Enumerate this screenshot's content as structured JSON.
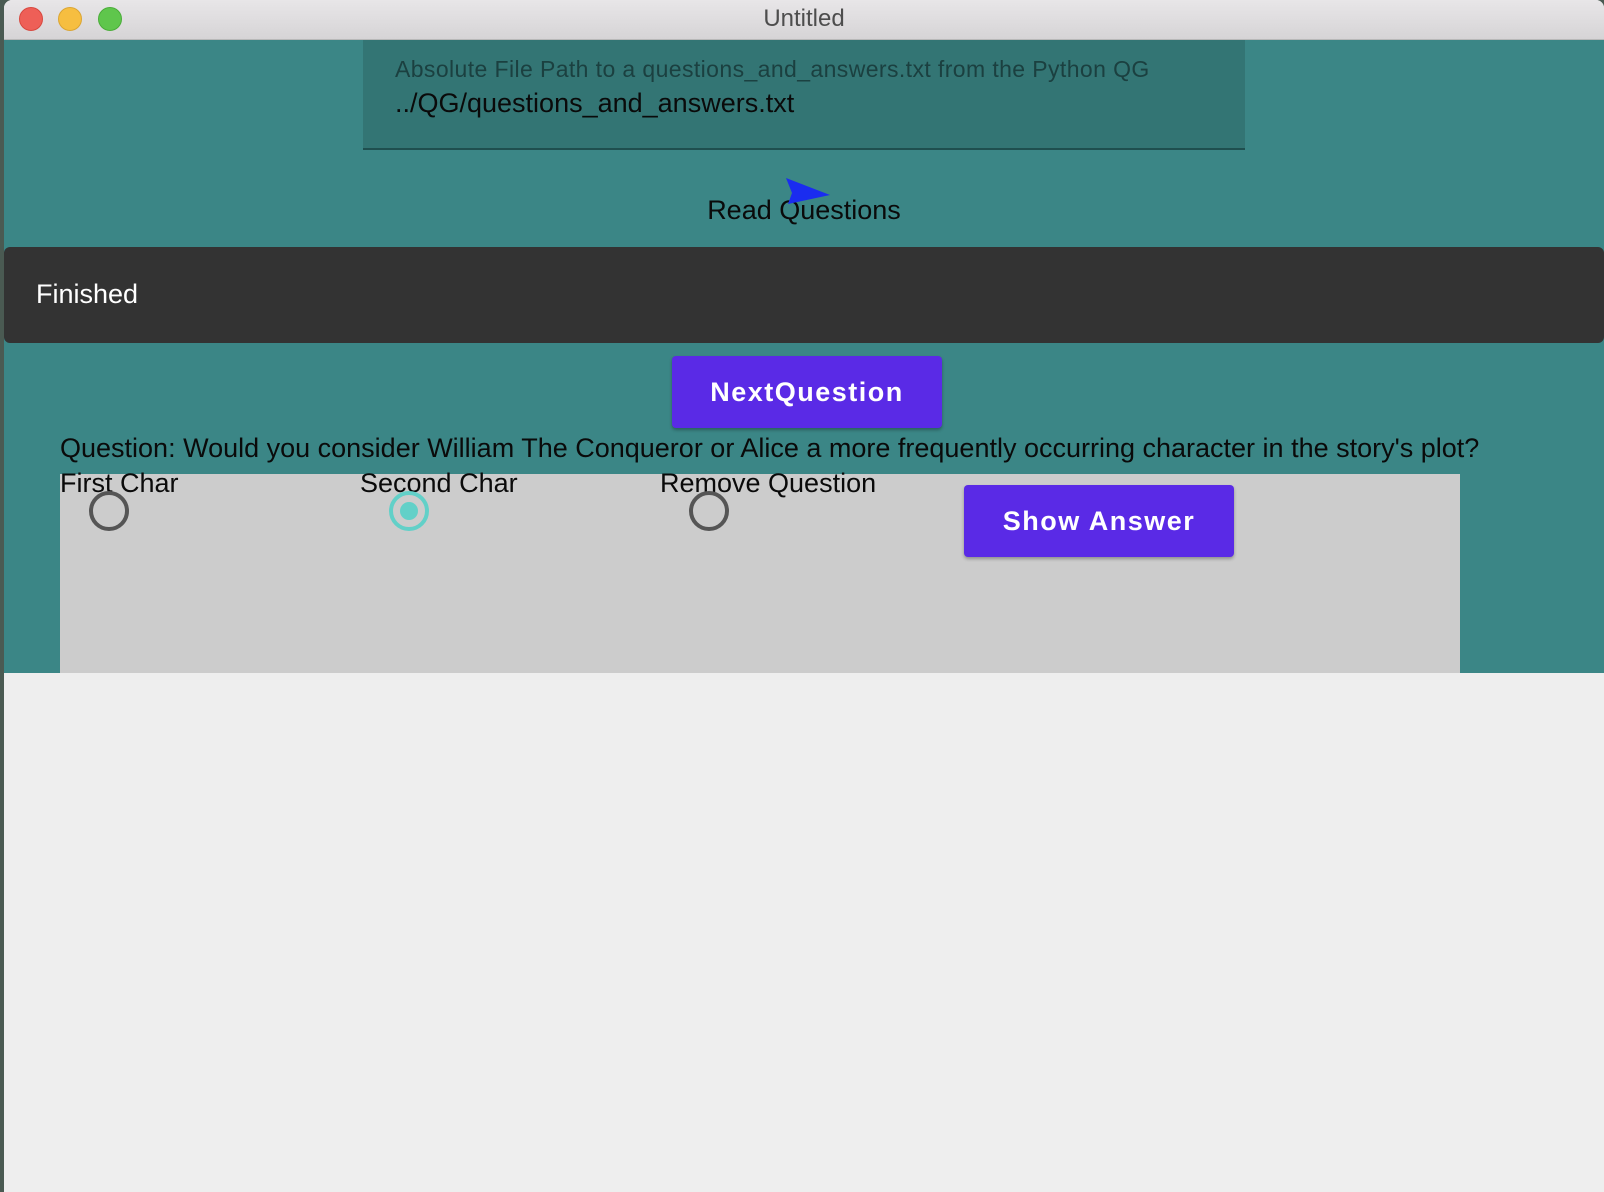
{
  "window": {
    "title": "Untitled"
  },
  "file_path_field": {
    "placeholder": "Absolute File Path to a questions_and_answers.txt from the Python QG",
    "value": "../QG/questions_and_answers.txt"
  },
  "read_button": {
    "label": "Read Questions",
    "icon": "send-icon"
  },
  "snackbar": {
    "message": "Finished"
  },
  "next_button": {
    "label": "NextQuestion"
  },
  "question": {
    "text": "Question: Would you consider William The Conqueror or Alice a more frequently occurring character in the story's plot?"
  },
  "options": [
    {
      "label": "First Char",
      "selected": false
    },
    {
      "label": "Second Char",
      "selected": true
    },
    {
      "label": "Remove Question",
      "selected": false
    }
  ],
  "show_answer_button": {
    "label": "Show Answer"
  },
  "colors": {
    "background": "#3b8686",
    "field": "#337574",
    "snackbar": "#333333",
    "button": "#5a2ae6",
    "radio_selected": "#62d0c8",
    "panel": "#cccccc",
    "send_icon": "#1a2cf0"
  }
}
